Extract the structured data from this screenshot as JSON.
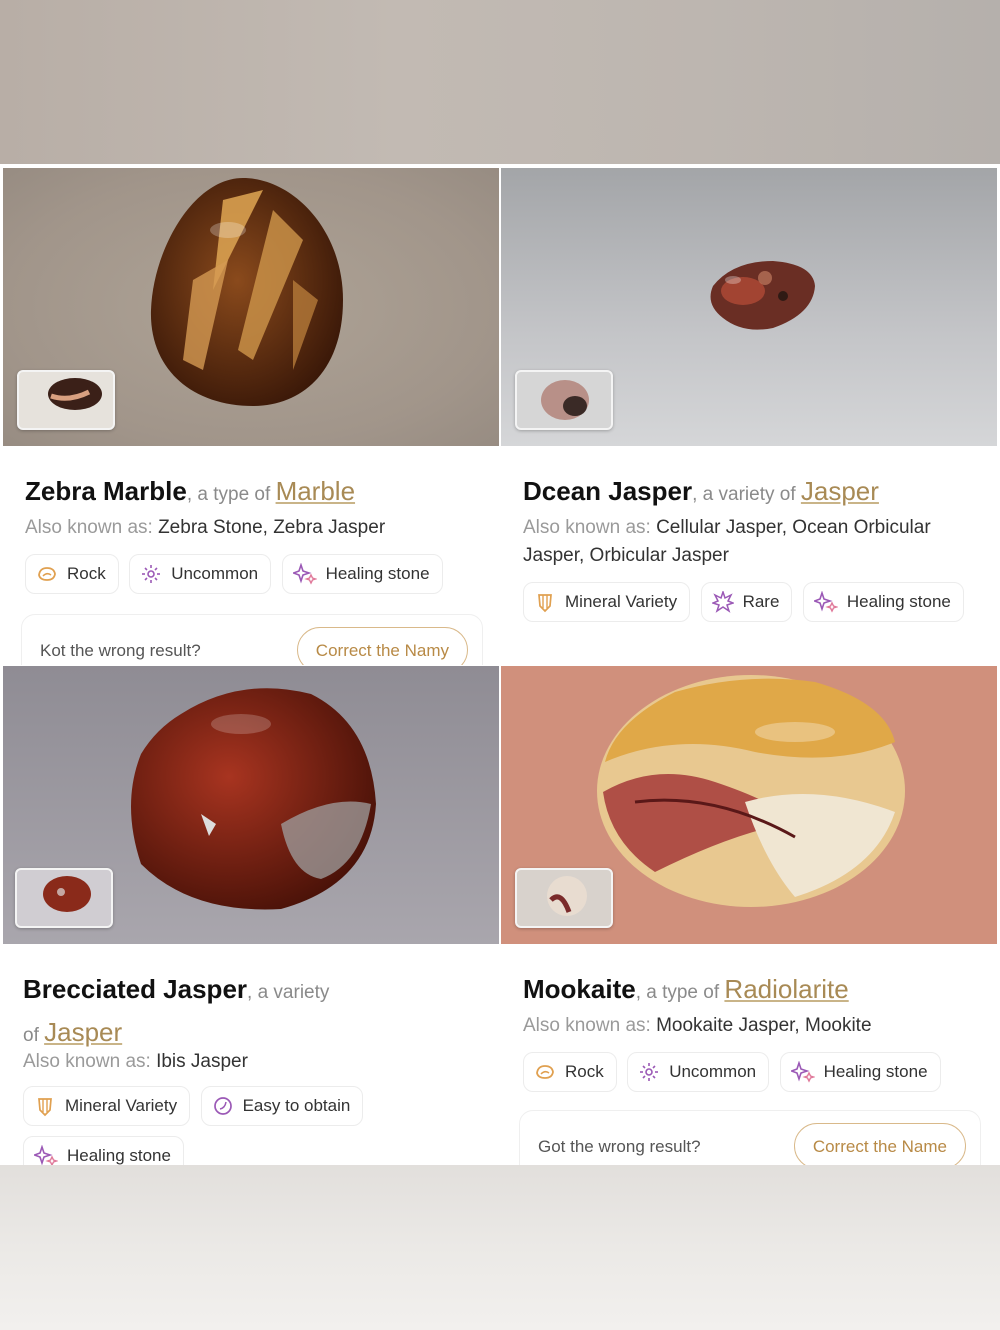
{
  "colors": {
    "accent": "#a88a55",
    "button_text": "#b88a46",
    "healing_icon": "#9b59b6",
    "rock_icon": "#e0a050"
  },
  "cards": [
    {
      "name": "Zebra Marble",
      "kind": ", a type of ",
      "parent": "Marble",
      "aka_label": "Also known as: ",
      "aka_value": "Zebra Stone, Zebra Jasper",
      "chips": [
        {
          "label": "Rock",
          "icon": "rock-icon"
        },
        {
          "label": "Uncommon",
          "icon": "sparkle-icon"
        },
        {
          "label": "Healing stone",
          "icon": "healing-stone-icon"
        }
      ],
      "feedback_text": "Kot the wrong result?",
      "feedback_button": "Correct the Namy"
    },
    {
      "name": "Dcean Jasper",
      "kind": ", a variety of ",
      "parent": "Jasper",
      "aka_label": "Also known as: ",
      "aka_value": "Cellular Jasper, Ocean Orbicular Jasper, Orbicular Jasper",
      "chips": [
        {
          "label": "Mineral Variety",
          "icon": "mineral-icon"
        },
        {
          "label": "Rare",
          "icon": "starburst-icon"
        },
        {
          "label": "Healing stone",
          "icon": "healing-stone-icon"
        }
      ]
    },
    {
      "name": "Brecciated Jasper",
      "kind": ", a variety of ",
      "parent": "Jasper",
      "aka_label": "Also known as: ",
      "aka_value": "Ibis Jasper",
      "chips": [
        {
          "label": "Mineral Variety",
          "icon": "mineral-icon"
        },
        {
          "label": "Easy to obtain",
          "icon": "easy-icon"
        },
        {
          "label": "Healing stone",
          "icon": "healing-stone-icon"
        }
      ]
    },
    {
      "name": "Mookaite",
      "kind": ", a type of ",
      "parent": "Radiolarite",
      "aka_label": "Also known as: ",
      "aka_value": "Mookaite Jasper, Mookite",
      "chips": [
        {
          "label": "Rock",
          "icon": "rock-icon"
        },
        {
          "label": "Uncommon",
          "icon": "sparkle-icon"
        },
        {
          "label": "Healing stone",
          "icon": "healing-stone-icon"
        }
      ],
      "feedback_text": "Got the wrong result?",
      "feedback_button": "Correct the Name"
    }
  ]
}
